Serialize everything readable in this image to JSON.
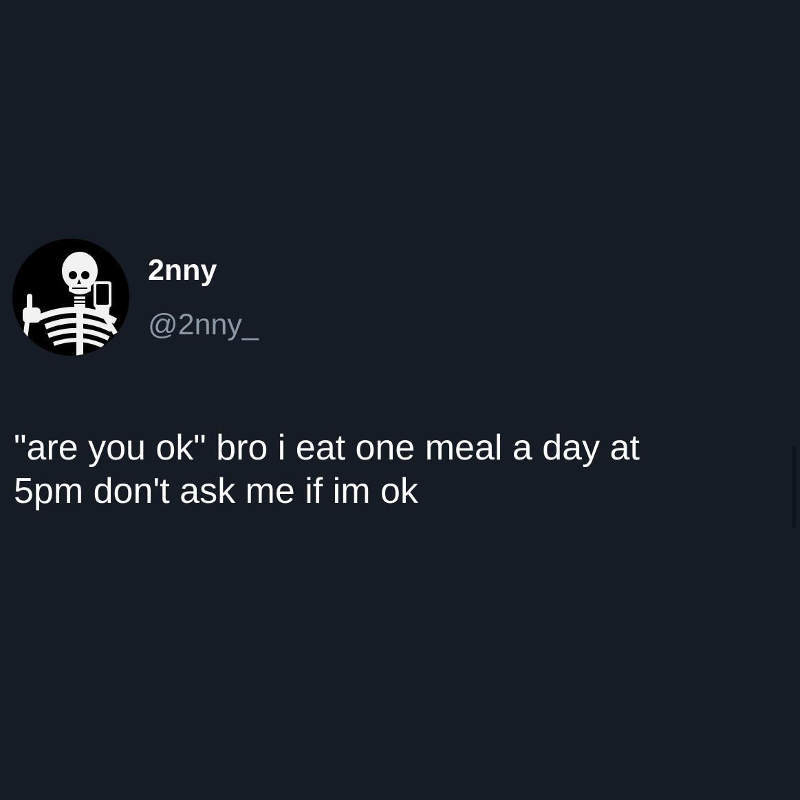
{
  "tweet": {
    "display_name": "2nny",
    "handle": "@2nny_",
    "text": "\"are you ok\" bro i eat one meal a day at\n5pm don't ask me if im ok",
    "avatar_icon": "skeleton-avatar-icon"
  },
  "colors": {
    "background": "#151c26",
    "primary_text": "#ffffff",
    "secondary_text": "#8b98a5"
  }
}
